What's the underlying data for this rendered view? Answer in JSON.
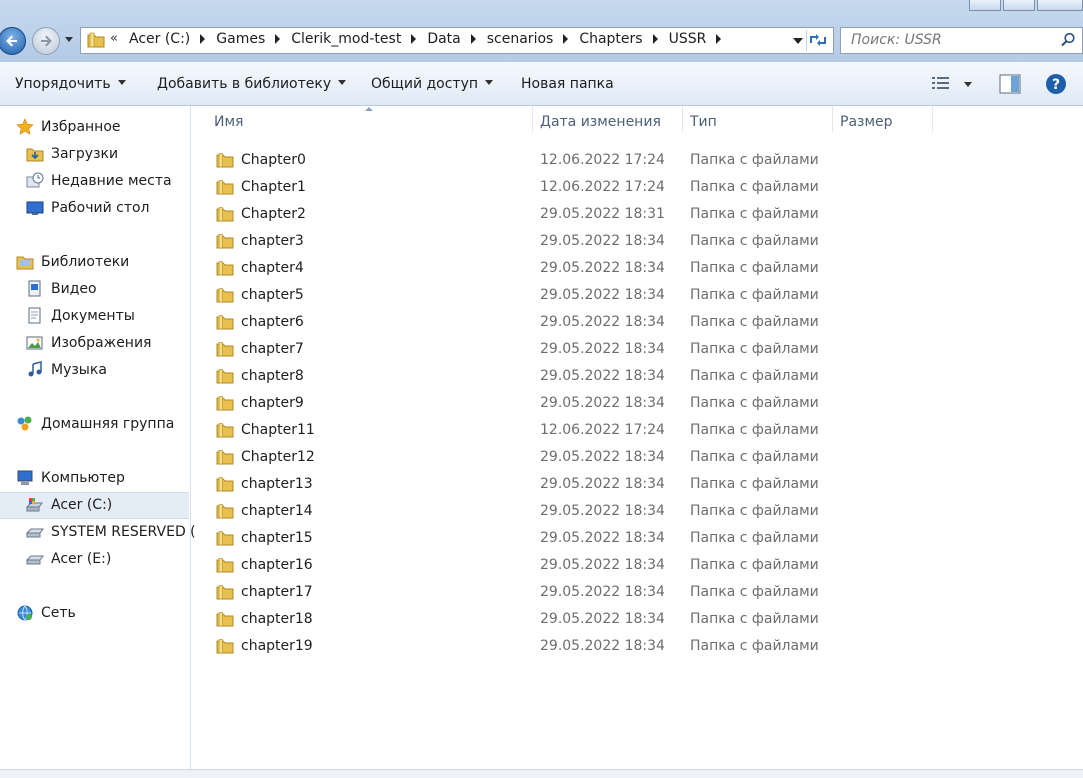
{
  "address": {
    "overflow_glyph": "«",
    "crumbs": [
      "Acer (C:)",
      "Games",
      "Clerik_mod-test",
      "Data",
      "scenarios",
      "Chapters",
      "USSR"
    ]
  },
  "search": {
    "placeholder": "Поиск: USSR"
  },
  "toolbar": {
    "organize": "Упорядочить",
    "add_to_library": "Добавить в библиотеку",
    "share": "Общий доступ",
    "new_folder": "Новая папка"
  },
  "nav": {
    "favorites": "Избранное",
    "downloads": "Загрузки",
    "recent": "Недавние места",
    "desktop": "Рабочий стол",
    "libraries": "Библиотеки",
    "video": "Видео",
    "documents": "Документы",
    "images": "Изображения",
    "music": "Музыка",
    "homegroup": "Домашняя группа",
    "computer": "Компьютер",
    "drive_c": "Acer (C:)",
    "system_reserved": "SYSTEM RESERVED (",
    "drive_e": "Acer (E:)",
    "network": "Сеть"
  },
  "columns": {
    "name": "Имя",
    "date": "Дата изменения",
    "type": "Тип",
    "size": "Размер"
  },
  "files": [
    {
      "name": "Chapter0",
      "date": "12.06.2022 17:24",
      "type": "Папка с файлами"
    },
    {
      "name": "Chapter1",
      "date": "12.06.2022 17:24",
      "type": "Папка с файлами"
    },
    {
      "name": "Chapter2",
      "date": "29.05.2022 18:31",
      "type": "Папка с файлами"
    },
    {
      "name": "chapter3",
      "date": "29.05.2022 18:34",
      "type": "Папка с файлами"
    },
    {
      "name": "chapter4",
      "date": "29.05.2022 18:34",
      "type": "Папка с файлами"
    },
    {
      "name": "chapter5",
      "date": "29.05.2022 18:34",
      "type": "Папка с файлами"
    },
    {
      "name": "chapter6",
      "date": "29.05.2022 18:34",
      "type": "Папка с файлами"
    },
    {
      "name": "chapter7",
      "date": "29.05.2022 18:34",
      "type": "Папка с файлами"
    },
    {
      "name": "chapter8",
      "date": "29.05.2022 18:34",
      "type": "Папка с файлами"
    },
    {
      "name": "chapter9",
      "date": "29.05.2022 18:34",
      "type": "Папка с файлами"
    },
    {
      "name": "Chapter11",
      "date": "12.06.2022 17:24",
      "type": "Папка с файлами"
    },
    {
      "name": "Chapter12",
      "date": "29.05.2022 18:34",
      "type": "Папка с файлами"
    },
    {
      "name": "chapter13",
      "date": "29.05.2022 18:34",
      "type": "Папка с файлами"
    },
    {
      "name": "chapter14",
      "date": "29.05.2022 18:34",
      "type": "Папка с файлами"
    },
    {
      "name": "chapter15",
      "date": "29.05.2022 18:34",
      "type": "Папка с файлами"
    },
    {
      "name": "chapter16",
      "date": "29.05.2022 18:34",
      "type": "Папка с файлами"
    },
    {
      "name": "chapter17",
      "date": "29.05.2022 18:34",
      "type": "Папка с файлами"
    },
    {
      "name": "chapter18",
      "date": "29.05.2022 18:34",
      "type": "Папка с файлами"
    },
    {
      "name": "chapter19",
      "date": "29.05.2022 18:34",
      "type": "Папка с файлами"
    }
  ],
  "icons": {
    "folder_color": "#e8c04f",
    "accent": "#1f5ea8"
  }
}
